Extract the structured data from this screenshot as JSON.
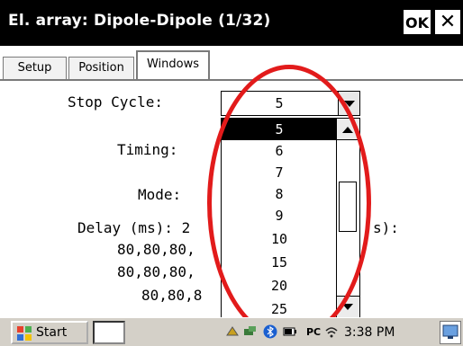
{
  "window": {
    "title": "El. array: Dipole-Dipole (1/32)",
    "ok_label": "OK",
    "close_label": "✕"
  },
  "tabs": [
    {
      "label": "Setup",
      "active": false
    },
    {
      "label": "Position",
      "active": false
    },
    {
      "label": "Windows",
      "active": true
    }
  ],
  "form": {
    "stop_cycle_label": "Stop Cycle:",
    "stop_cycle_value": "5",
    "timing_label": "Timing:",
    "mode_label": "Mode:",
    "delay_label_left": "Delay (ms): 2",
    "delay_label_right": "s):",
    "delay_values": [
      "80,80,80,",
      "80,80,80,",
      "80,80,8"
    ]
  },
  "dropdown": {
    "options": [
      "5",
      "6",
      "7",
      "8",
      "9",
      "10",
      "15",
      "20",
      "25"
    ],
    "selected": "5"
  },
  "annotation": {
    "color": "#e21b1b",
    "shape": "ellipse"
  },
  "taskbar": {
    "start_label": "Start",
    "pc_label": "PC",
    "clock": "3:38 PM"
  },
  "colors": {
    "titlebar_bg": "#000000",
    "selection_bg": "#000000",
    "taskbar_bg": "#d4d0c8"
  }
}
